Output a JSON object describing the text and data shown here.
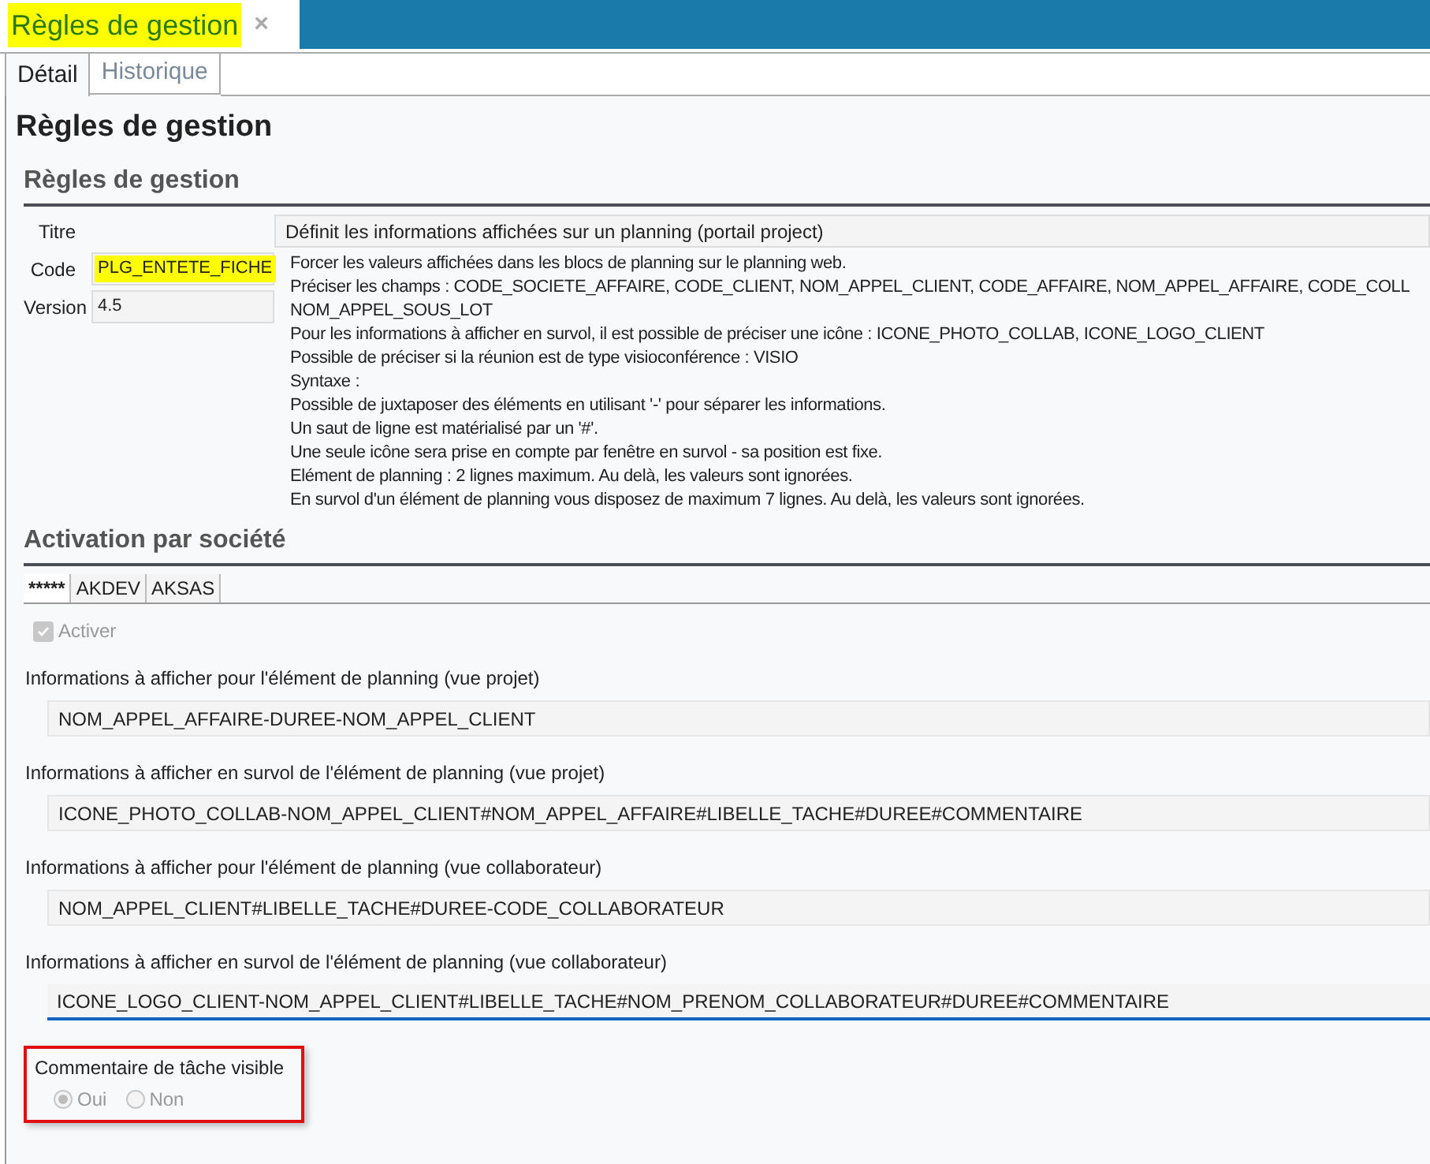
{
  "document_tab": {
    "title": "Règles de gestion",
    "highlighted": true,
    "close": "×"
  },
  "tabs": [
    {
      "label": "Détail",
      "selected": true
    },
    {
      "label": "Historique",
      "selected": false
    }
  ],
  "page_title": "Règles de gestion",
  "rules_section": {
    "heading": "Règles de gestion",
    "fields": [
      {
        "label": "Titre",
        "value": "Définit les informations affichées sur un planning (portail project)",
        "highlighted": false
      },
      {
        "label": "Code",
        "value": "PLG_ENTETE_FICHE",
        "highlighted": true
      },
      {
        "label": "Version",
        "value": "4.5",
        "highlighted": false
      }
    ],
    "description": [
      "Forcer les valeurs affichées dans les blocs de planning sur le planning web.",
      "Préciser les champs : CODE_SOCIETE_AFFAIRE, CODE_CLIENT, NOM_APPEL_CLIENT, CODE_AFFAIRE, NOM_APPEL_AFFAIRE, CODE_COLL",
      "NOM_APPEL_SOUS_LOT",
      "Pour les informations à afficher en survol, il est possible de préciser une icône : ICONE_PHOTO_COLLAB, ICONE_LOGO_CLIENT",
      "Possible de préciser si la réunion est de type visioconférence : VISIO",
      "Syntaxe :",
      "Possible de juxtaposer des éléments en utilisant '-' pour séparer les informations.",
      "Un saut de ligne est matérialisé par un '#'.",
      "Une seule icône sera prise en compte par fenêtre en survol - sa position est fixe.",
      "Elément de planning : 2 lignes maximum. Au delà, les valeurs sont ignorées.",
      "En survol d'un élément de planning vous disposez de maximum 7 lignes. Au delà, les valeurs sont ignorées."
    ]
  },
  "activation_section": {
    "heading": "Activation par société",
    "tabs": [
      {
        "label": "*****",
        "selected": true
      },
      {
        "label": "AKDEV",
        "selected": false
      },
      {
        "label": "AKSAS",
        "selected": false
      }
    ],
    "activate": {
      "label": "Activer",
      "checked": true,
      "disabled": true
    },
    "fields": [
      {
        "label": "Informations à afficher pour l'élément de planning (vue projet)",
        "value": "NOM_APPEL_AFFAIRE-DUREE-NOM_APPEL_CLIENT",
        "focused": false
      },
      {
        "label": "Informations à afficher en survol de l'élément de planning (vue projet)",
        "value": "ICONE_PHOTO_COLLAB-NOM_APPEL_CLIENT#NOM_APPEL_AFFAIRE#LIBELLE_TACHE#DUREE#COMMENTAIRE",
        "focused": false
      },
      {
        "label": "Informations à afficher pour l'élément de planning (vue collaborateur)",
        "value": "NOM_APPEL_CLIENT#LIBELLE_TACHE#DUREE-CODE_COLLABORATEUR",
        "focused": false
      },
      {
        "label": "Informations à afficher en survol de l'élément de planning (vue collaborateur)",
        "value": "ICONE_LOGO_CLIENT-NOM_APPEL_CLIENT#LIBELLE_TACHE#NOM_PRENOM_COLLABORATEUR#DUREE#COMMENTAIRE",
        "focused": true
      }
    ],
    "comment_visible": {
      "label": "Commentaire de tâche visible",
      "outlined": true,
      "disabled": true,
      "options": [
        {
          "label": "Oui",
          "selected": true
        },
        {
          "label": "Non",
          "selected": false
        }
      ]
    }
  }
}
